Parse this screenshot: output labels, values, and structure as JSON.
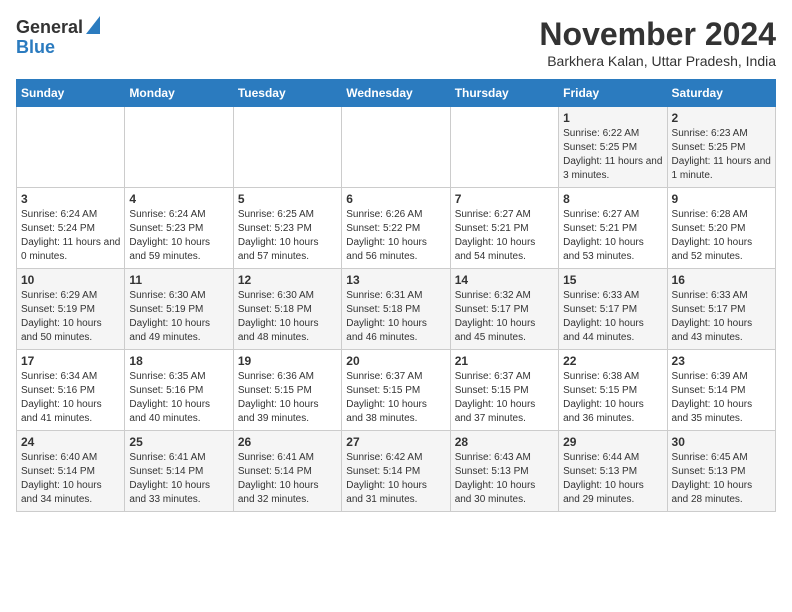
{
  "header": {
    "logo_line1": "General",
    "logo_line2": "Blue",
    "title": "November 2024",
    "subtitle": "Barkhera Kalan, Uttar Pradesh, India"
  },
  "days_of_week": [
    "Sunday",
    "Monday",
    "Tuesday",
    "Wednesday",
    "Thursday",
    "Friday",
    "Saturday"
  ],
  "weeks": [
    [
      {
        "day": "",
        "info": ""
      },
      {
        "day": "",
        "info": ""
      },
      {
        "day": "",
        "info": ""
      },
      {
        "day": "",
        "info": ""
      },
      {
        "day": "",
        "info": ""
      },
      {
        "day": "1",
        "info": "Sunrise: 6:22 AM\nSunset: 5:25 PM\nDaylight: 11 hours and 3 minutes."
      },
      {
        "day": "2",
        "info": "Sunrise: 6:23 AM\nSunset: 5:25 PM\nDaylight: 11 hours and 1 minute."
      }
    ],
    [
      {
        "day": "3",
        "info": "Sunrise: 6:24 AM\nSunset: 5:24 PM\nDaylight: 11 hours and 0 minutes."
      },
      {
        "day": "4",
        "info": "Sunrise: 6:24 AM\nSunset: 5:23 PM\nDaylight: 10 hours and 59 minutes."
      },
      {
        "day": "5",
        "info": "Sunrise: 6:25 AM\nSunset: 5:23 PM\nDaylight: 10 hours and 57 minutes."
      },
      {
        "day": "6",
        "info": "Sunrise: 6:26 AM\nSunset: 5:22 PM\nDaylight: 10 hours and 56 minutes."
      },
      {
        "day": "7",
        "info": "Sunrise: 6:27 AM\nSunset: 5:21 PM\nDaylight: 10 hours and 54 minutes."
      },
      {
        "day": "8",
        "info": "Sunrise: 6:27 AM\nSunset: 5:21 PM\nDaylight: 10 hours and 53 minutes."
      },
      {
        "day": "9",
        "info": "Sunrise: 6:28 AM\nSunset: 5:20 PM\nDaylight: 10 hours and 52 minutes."
      }
    ],
    [
      {
        "day": "10",
        "info": "Sunrise: 6:29 AM\nSunset: 5:19 PM\nDaylight: 10 hours and 50 minutes."
      },
      {
        "day": "11",
        "info": "Sunrise: 6:30 AM\nSunset: 5:19 PM\nDaylight: 10 hours and 49 minutes."
      },
      {
        "day": "12",
        "info": "Sunrise: 6:30 AM\nSunset: 5:18 PM\nDaylight: 10 hours and 48 minutes."
      },
      {
        "day": "13",
        "info": "Sunrise: 6:31 AM\nSunset: 5:18 PM\nDaylight: 10 hours and 46 minutes."
      },
      {
        "day": "14",
        "info": "Sunrise: 6:32 AM\nSunset: 5:17 PM\nDaylight: 10 hours and 45 minutes."
      },
      {
        "day": "15",
        "info": "Sunrise: 6:33 AM\nSunset: 5:17 PM\nDaylight: 10 hours and 44 minutes."
      },
      {
        "day": "16",
        "info": "Sunrise: 6:33 AM\nSunset: 5:17 PM\nDaylight: 10 hours and 43 minutes."
      }
    ],
    [
      {
        "day": "17",
        "info": "Sunrise: 6:34 AM\nSunset: 5:16 PM\nDaylight: 10 hours and 41 minutes."
      },
      {
        "day": "18",
        "info": "Sunrise: 6:35 AM\nSunset: 5:16 PM\nDaylight: 10 hours and 40 minutes."
      },
      {
        "day": "19",
        "info": "Sunrise: 6:36 AM\nSunset: 5:15 PM\nDaylight: 10 hours and 39 minutes."
      },
      {
        "day": "20",
        "info": "Sunrise: 6:37 AM\nSunset: 5:15 PM\nDaylight: 10 hours and 38 minutes."
      },
      {
        "day": "21",
        "info": "Sunrise: 6:37 AM\nSunset: 5:15 PM\nDaylight: 10 hours and 37 minutes."
      },
      {
        "day": "22",
        "info": "Sunrise: 6:38 AM\nSunset: 5:15 PM\nDaylight: 10 hours and 36 minutes."
      },
      {
        "day": "23",
        "info": "Sunrise: 6:39 AM\nSunset: 5:14 PM\nDaylight: 10 hours and 35 minutes."
      }
    ],
    [
      {
        "day": "24",
        "info": "Sunrise: 6:40 AM\nSunset: 5:14 PM\nDaylight: 10 hours and 34 minutes."
      },
      {
        "day": "25",
        "info": "Sunrise: 6:41 AM\nSunset: 5:14 PM\nDaylight: 10 hours and 33 minutes."
      },
      {
        "day": "26",
        "info": "Sunrise: 6:41 AM\nSunset: 5:14 PM\nDaylight: 10 hours and 32 minutes."
      },
      {
        "day": "27",
        "info": "Sunrise: 6:42 AM\nSunset: 5:14 PM\nDaylight: 10 hours and 31 minutes."
      },
      {
        "day": "28",
        "info": "Sunrise: 6:43 AM\nSunset: 5:13 PM\nDaylight: 10 hours and 30 minutes."
      },
      {
        "day": "29",
        "info": "Sunrise: 6:44 AM\nSunset: 5:13 PM\nDaylight: 10 hours and 29 minutes."
      },
      {
        "day": "30",
        "info": "Sunrise: 6:45 AM\nSunset: 5:13 PM\nDaylight: 10 hours and 28 minutes."
      }
    ]
  ]
}
